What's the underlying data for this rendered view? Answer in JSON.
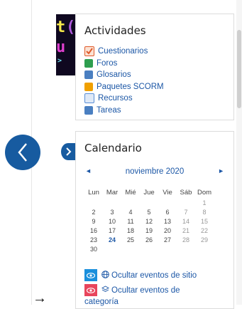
{
  "activities": {
    "title": "Actividades",
    "items": [
      {
        "label": "Cuestionarios",
        "icon": "quiz-icon",
        "color": "#e05a2a"
      },
      {
        "label": "Foros",
        "icon": "forum-icon",
        "color": "#2e9e4f"
      },
      {
        "label": "Glosarios",
        "icon": "glossary-icon",
        "color": "#4a7fc1"
      },
      {
        "label": "Paquetes SCORM",
        "icon": "scorm-icon",
        "color": "#f0a000"
      },
      {
        "label": "Recursos",
        "icon": "resource-icon",
        "color": "#5a8fd6"
      },
      {
        "label": "Tareas",
        "icon": "assignment-icon",
        "color": "#4a7fc1"
      }
    ]
  },
  "calendar": {
    "title": "Calendario",
    "month": "noviembre 2020",
    "prev_symbol": "◄",
    "next_symbol": "►",
    "weekdays": [
      "Lun",
      "Mar",
      "Mié",
      "Jue",
      "Vie",
      "Sáb",
      "Dom"
    ],
    "weeks": [
      [
        "",
        "",
        "",
        "",
        "",
        "",
        "1"
      ],
      [
        "2",
        "3",
        "4",
        "5",
        "6",
        "7",
        "8"
      ],
      [
        "9",
        "10",
        "11",
        "12",
        "13",
        "14",
        "15"
      ],
      [
        "16",
        "17",
        "18",
        "19",
        "20",
        "21",
        "22"
      ],
      [
        "23",
        "24",
        "25",
        "26",
        "27",
        "28",
        "29"
      ],
      [
        "30",
        "",
        "",
        "",
        "",
        "",
        ""
      ]
    ],
    "today": "24",
    "toggles": [
      {
        "label": "Ocultar eventos de sitio",
        "icon": "globe-icon",
        "color": "#1a8fdc"
      },
      {
        "label": "Ocultar eventos de",
        "icon": "layers-icon",
        "color": "#e8455c"
      }
    ],
    "continued_text": "categoría"
  },
  "footer_arrow": "→",
  "colors": {
    "accent": "#175ba0",
    "link": "#1c57a6"
  }
}
